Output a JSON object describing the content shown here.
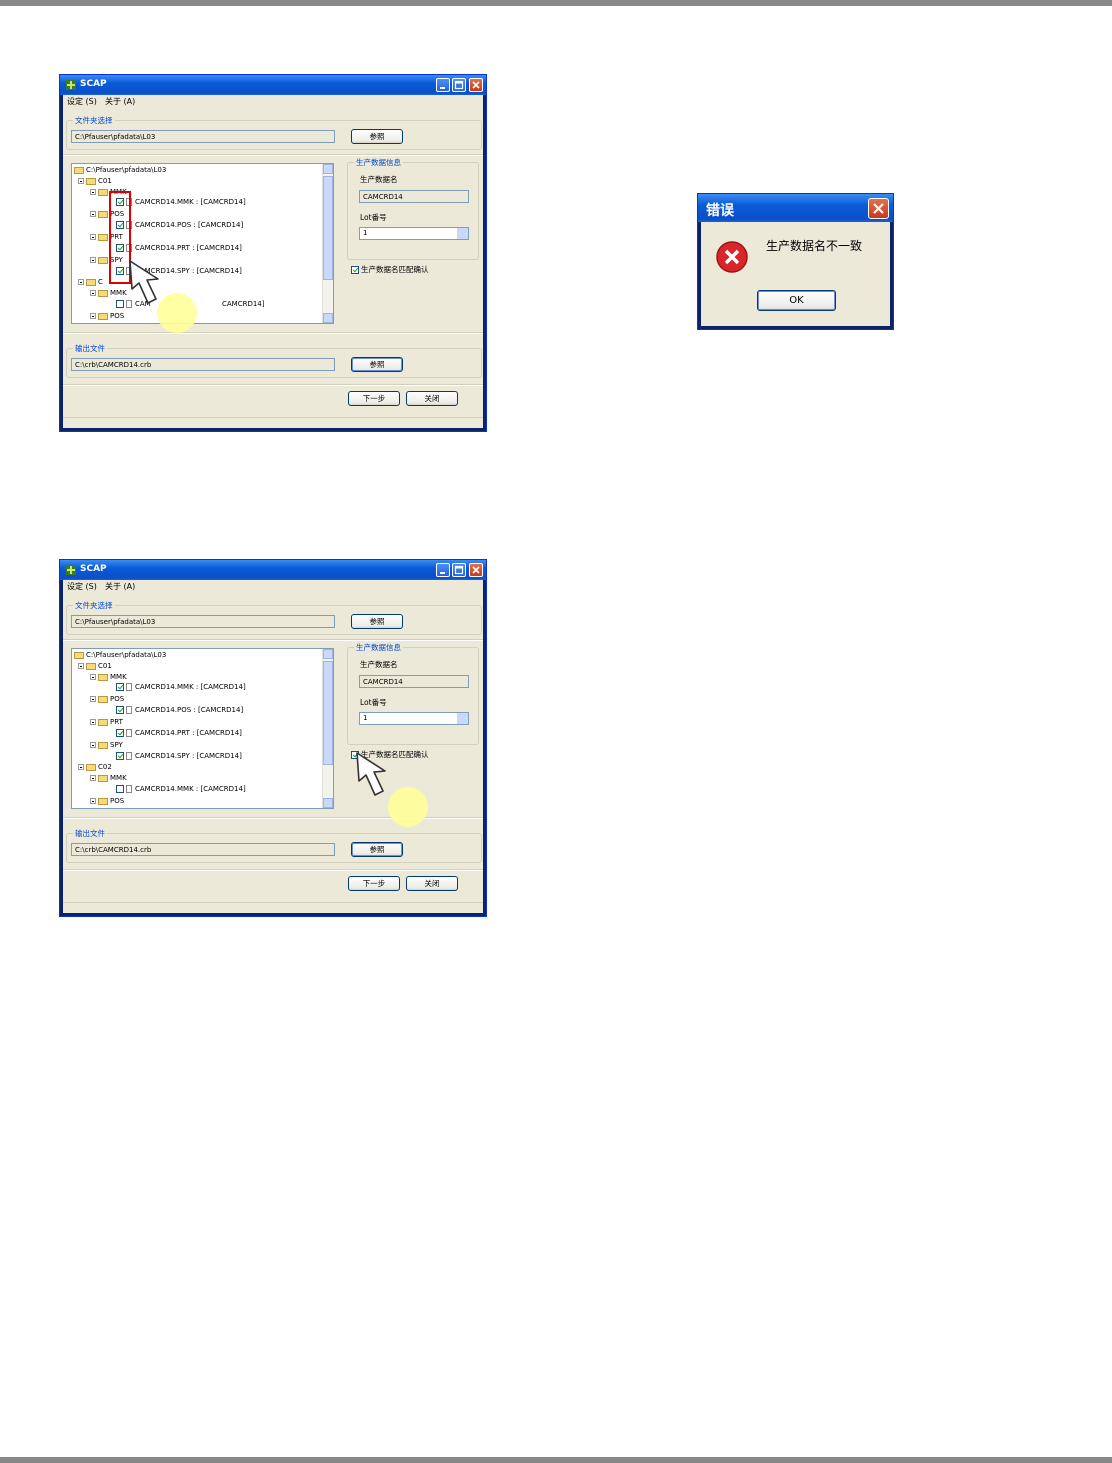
{
  "windows": [
    {
      "title": "SCAP",
      "menu": [
        "设定 (S)",
        "关于 (A)"
      ],
      "folder_group_title": "文件夹选择",
      "folder_path": "C:\\Pfauser\\pfadata\\L03",
      "browse_label": "参照",
      "tree": {
        "root": "C:\\Pfauser\\pfadata\\L03",
        "nodes": [
          "C01",
          "MMK",
          "CAMCRD14.MMK : [CAMCRD14]",
          "POS",
          "CAMCRD14.POS : [CAMCRD14]",
          "PRT",
          "CAMCRD14.PRT : [CAMCRD14]",
          "SPY",
          "CAMCRD14.SPY : [CAMCRD14]",
          "C",
          "MMK",
          "CAM",
          "CAMCRD14]",
          "POS"
        ]
      },
      "info_group_title": "生产数据信息",
      "prod_name_label": "生产数据名",
      "prod_name_value": "CAMCRD14",
      "lot_label": "Lot番号",
      "lot_value": "1",
      "confirm_label": "生产数据名匹配确认",
      "output_group_title": "输出文件",
      "output_path": "C:\\crb\\CAMCRD14.crb",
      "output_browse_label": "参照",
      "next_label": "下一步",
      "close_label": "关闭"
    },
    {
      "title": "SCAP",
      "menu": [
        "设定 (S)",
        "关于 (A)"
      ],
      "folder_group_title": "文件夹选择",
      "folder_path": "C:\\Pfauser\\pfadata\\L03",
      "browse_label": "参照",
      "tree": {
        "root": "C:\\Pfauser\\pfadata\\L03",
        "nodes": [
          "C01",
          "MMK",
          "CAMCRD14.MMK : [CAMCRD14]",
          "POS",
          "CAMCRD14.POS : [CAMCRD14]",
          "PRT",
          "CAMCRD14.PRT : [CAMCRD14]",
          "SPY",
          "CAMCRD14.SPY : [CAMCRD14]",
          "C02",
          "MMK",
          "CAMCRD14.MMK : [CAMCRD14]",
          "POS"
        ]
      },
      "info_group_title": "生产数据信息",
      "prod_name_label": "生产数据名",
      "prod_name_value": "CAMCRD14",
      "lot_label": "Lot番号",
      "lot_value": "1",
      "confirm_label": "生产数据名匹配确认",
      "output_group_title": "输出文件",
      "output_path": "C:\\crb\\CAMCRD14.crb",
      "output_browse_label": "参照",
      "next_label": "下一步",
      "close_label": "关闭"
    }
  ],
  "error_dialog": {
    "title": "错误",
    "message": "生产数据名不一致",
    "ok_label": "OK"
  },
  "colors": {
    "title_blue": "#0b5bd6",
    "face": "#ece9d8",
    "group_title": "#0046d5",
    "marker": "#ffff99",
    "highlight_red": "#e00000"
  }
}
